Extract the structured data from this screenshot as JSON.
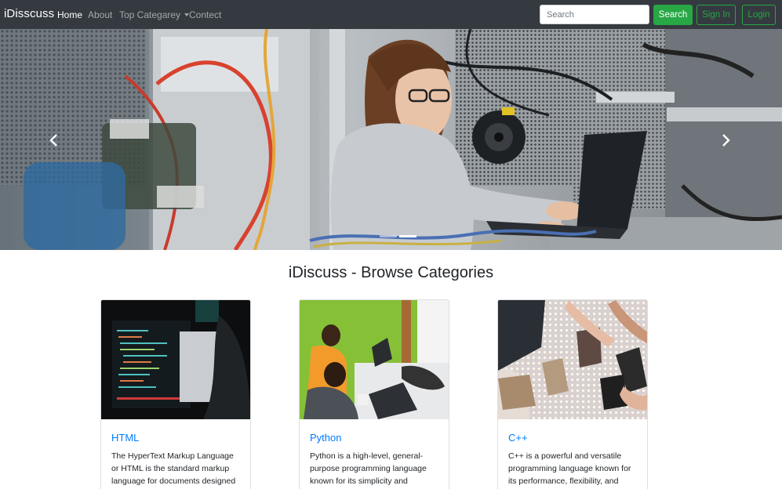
{
  "navbar": {
    "brand": "iDisscuss",
    "links": [
      {
        "label": "Home",
        "active": true
      },
      {
        "label": "About",
        "active": false
      },
      {
        "label": "Top Categarey",
        "active": false,
        "dropdown": true
      },
      {
        "label": "Contect",
        "active": false
      }
    ],
    "search_placeholder": "Search",
    "search_button": "Search",
    "signin_button": "Sign In",
    "login_button": "Login",
    "colors": {
      "bg": "#343a40",
      "accent": "#28a745"
    }
  },
  "carousel": {
    "slide_count": 2,
    "active_index": 1,
    "prev_icon": "chevron-left-icon",
    "next_icon": "chevron-right-icon"
  },
  "section": {
    "heading": "iDiscuss - Browse Categories"
  },
  "cards": [
    {
      "title": "HTML",
      "text": "The HyperText Markup Language or HTML is the standard markup language for documents designed"
    },
    {
      "title": "Python",
      "text": "Python is a high-level, general-purpose programming language known for its simplicity and"
    },
    {
      "title": "C++",
      "text": "C++ is a powerful and versatile programming language known for its performance, flexibility, and"
    }
  ],
  "colors": {
    "link": "#007bff",
    "success": "#28a745"
  }
}
